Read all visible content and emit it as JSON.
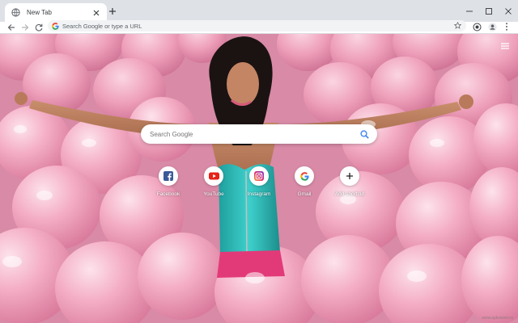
{
  "browser": {
    "tab": {
      "title": "New Tab"
    },
    "omnibox": {
      "placeholder": "Search Google or type a URL"
    }
  },
  "page": {
    "search": {
      "placeholder": "Search Google"
    },
    "shortcuts": [
      {
        "label": "Facebook",
        "icon": "facebook-icon",
        "color": "#3b5998"
      },
      {
        "label": "YouTube",
        "icon": "youtube-icon",
        "color": "#e62117"
      },
      {
        "label": "Instagram",
        "icon": "instagram-icon",
        "color": "#c13584"
      },
      {
        "label": "Gmail",
        "icon": "google-icon",
        "color": "#4285f4"
      },
      {
        "label": "Add shortcut",
        "icon": "plus-icon",
        "color": "#202124"
      }
    ],
    "watermark": "www.apkvision.ru"
  },
  "colors": {
    "tabstrip": "#dee1e6",
    "accent": "#1a73e8",
    "balloon_pink": "#f2a7c0",
    "top_color": "#2ec4c4"
  }
}
